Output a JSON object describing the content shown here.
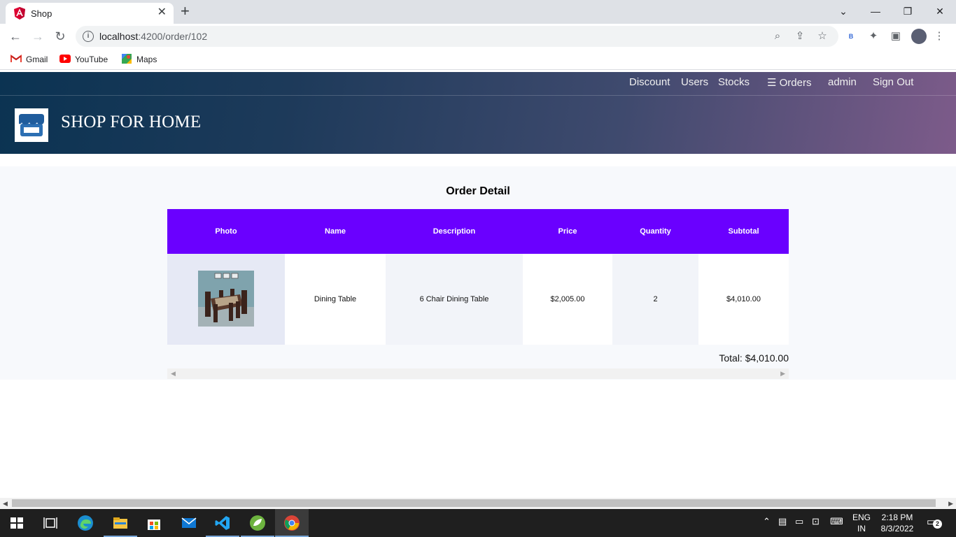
{
  "browser": {
    "tab_title": "Shop",
    "tab_close": "✕",
    "new_tab": "+",
    "url_host": "localhost",
    "url_path": ":4200/order/102",
    "profile_badge": "B",
    "window_controls": {
      "minimize": "—",
      "restore": "❐",
      "close": "✕",
      "tab_search": "⌄"
    }
  },
  "bookmarks": [
    {
      "label": "Gmail",
      "icon": "gmail-icon"
    },
    {
      "label": "YouTube",
      "icon": "youtube-icon"
    },
    {
      "label": "Maps",
      "icon": "maps-icon"
    }
  ],
  "nav": {
    "discount": "Discount",
    "users": "Users",
    "stocks": "Stocks",
    "orders": "Orders",
    "orders_icon": "☰",
    "admin": "admin",
    "signout": "Sign Out"
  },
  "brand": {
    "name": "SHOP FOR HOME"
  },
  "order": {
    "title": "Order Detail",
    "columns": [
      "Photo",
      "Name",
      "Description",
      "Price",
      "Quantity",
      "Subtotal"
    ],
    "items": [
      {
        "name": "Dining Table",
        "description": "6 Chair Dining Table",
        "price": "$2,005.00",
        "quantity": "2",
        "subtotal": "$4,010.00"
      }
    ],
    "total": "Total: $4,010.00"
  },
  "taskbar": {
    "lang_line1": "ENG",
    "lang_line2": "IN",
    "time": "2:18 PM",
    "date": "8/3/2022",
    "notifications": "2"
  },
  "colors": {
    "table_header": "#6a00ff",
    "header_start": "#0b3352",
    "header_end": "#7d5b8a"
  }
}
